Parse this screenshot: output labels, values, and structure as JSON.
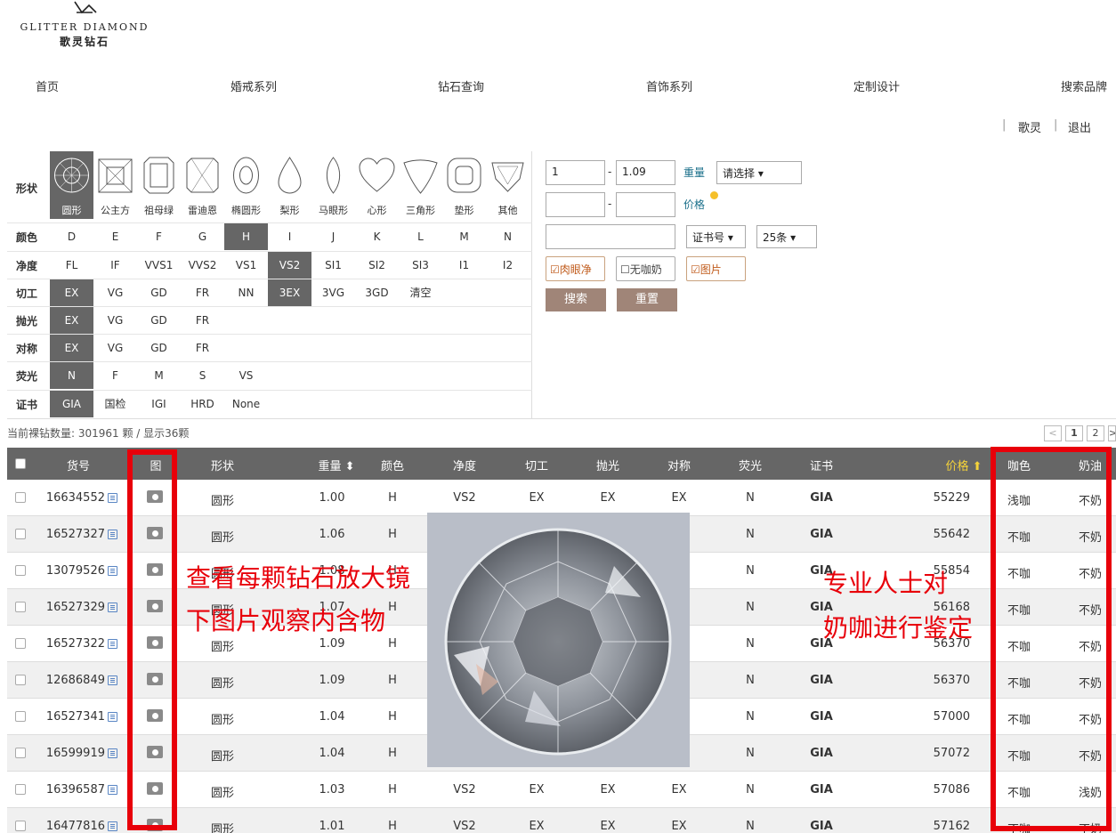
{
  "brand": {
    "name_en": "GLITTER DIAMOND",
    "name_cn": "歌灵钻石"
  },
  "nav": [
    "首页",
    "婚戒系列",
    "钻石查询",
    "首饰系列",
    "定制设计",
    "搜索品牌"
  ],
  "user": {
    "sep": "|",
    "name": "歌灵",
    "logout": "退出"
  },
  "filters": {
    "shape_label": "形状",
    "shapes": [
      "圆形",
      "公主方",
      "祖母绿",
      "雷迪恩",
      "椭圆形",
      "梨形",
      "马眼形",
      "心形",
      "三角形",
      "垫形",
      "其他"
    ],
    "shape_selected": "圆形",
    "color_label": "颜色",
    "colors": [
      "D",
      "E",
      "F",
      "G",
      "H",
      "I",
      "J",
      "K",
      "L",
      "M",
      "N"
    ],
    "clarity_label": "净度",
    "clarity": [
      "FL",
      "IF",
      "VVS1",
      "VVS2",
      "VS1",
      "VS2",
      "SI1",
      "SI2",
      "SI3",
      "I1",
      "I2"
    ],
    "cut_label": "切工",
    "cut": [
      "EX",
      "VG",
      "GD",
      "FR",
      "NN",
      "3EX",
      "3VG",
      "3GD",
      "清空"
    ],
    "polish_label": "抛光",
    "polish": [
      "EX",
      "VG",
      "GD",
      "FR"
    ],
    "symmetry_label": "对称",
    "symmetry": [
      "EX",
      "VG",
      "GD",
      "FR"
    ],
    "fluor_label": "荧光",
    "fluor": [
      "N",
      "F",
      "M",
      "S",
      "VS"
    ],
    "cert_label": "证书",
    "cert": [
      "GIA",
      "国检",
      "IGI",
      "HRD",
      "None"
    ]
  },
  "search": {
    "weight_min": "1",
    "dash": "-",
    "weight_max": "1.09",
    "weight_label": "重量",
    "weight_select": "请选择 ▾",
    "price_label": "价格",
    "cert_select": "证书号 ▾",
    "page_size": "25条 ▾",
    "eye_clean": "肉眼净",
    "no_milk": "无咖奶",
    "picture": "图片",
    "search_btn": "搜索",
    "reset_btn": "重置"
  },
  "count_text": "当前裸钻数量: 301961 颗 / 显示36颗",
  "pagination": [
    "<",
    "1",
    "2",
    ">"
  ],
  "table": {
    "headers": [
      "货号",
      "图",
      "形状",
      "重量 ⬍",
      "颜色",
      "净度",
      "切工",
      "抛光",
      "对称",
      "荧光",
      "证书",
      "价格 ⬆",
      "咖色",
      "奶油"
    ],
    "rows": [
      [
        "16634552",
        "圆形",
        "1.00",
        "H",
        "VS2",
        "EX",
        "EX",
        "EX",
        "N",
        "GIA",
        "55229",
        "浅咖",
        "不奶"
      ],
      [
        "16527327",
        "圆形",
        "1.06",
        "H",
        "",
        "",
        "",
        "",
        "N",
        "GIA",
        "55642",
        "不咖",
        "不奶"
      ],
      [
        "13079526",
        "圆形",
        "1.08",
        "H",
        "",
        "",
        "",
        "",
        "N",
        "GIA",
        "55854",
        "不咖",
        "不奶"
      ],
      [
        "16527329",
        "圆形",
        "1.07",
        "H",
        "",
        "",
        "",
        "",
        "N",
        "GIA",
        "56168",
        "不咖",
        "不奶"
      ],
      [
        "16527322",
        "圆形",
        "1.09",
        "H",
        "",
        "",
        "",
        "",
        "N",
        "GIA",
        "56370",
        "不咖",
        "不奶"
      ],
      [
        "12686849",
        "圆形",
        "1.09",
        "H",
        "",
        "",
        "",
        "",
        "N",
        "GIA",
        "56370",
        "不咖",
        "不奶"
      ],
      [
        "16527341",
        "圆形",
        "1.04",
        "H",
        "",
        "",
        "",
        "",
        "N",
        "GIA",
        "57000",
        "不咖",
        "不奶"
      ],
      [
        "16599919",
        "圆形",
        "1.04",
        "H",
        "",
        "",
        "",
        "",
        "N",
        "GIA",
        "57072",
        "不咖",
        "不奶"
      ],
      [
        "16396587",
        "圆形",
        "1.03",
        "H",
        "VS2",
        "EX",
        "EX",
        "EX",
        "N",
        "GIA",
        "57086",
        "不咖",
        "浅奶"
      ],
      [
        "16477816",
        "圆形",
        "1.01",
        "H",
        "VS2",
        "EX",
        "EX",
        "EX",
        "N",
        "GIA",
        "57162",
        "不咖",
        "不奶"
      ]
    ]
  },
  "annotations": {
    "left_line1": "查看每颗钻石放大镜",
    "left_line2": "下图片观察内含物",
    "right_line1": "专业人士对",
    "right_line2": "奶咖进行鉴定"
  },
  "colors": {
    "accent_header": "#666666",
    "price_header": "#f5d33a",
    "annotation_red": "#e8000a",
    "button": "#a08578"
  }
}
